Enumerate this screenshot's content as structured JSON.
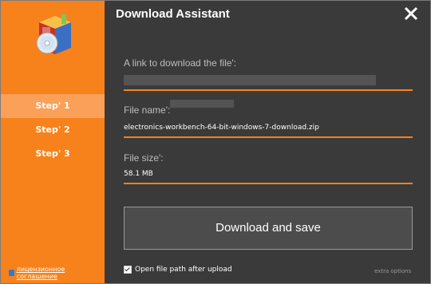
{
  "window": {
    "title": "Download Assistant"
  },
  "sidebar": {
    "steps": [
      {
        "label": "Step' 1",
        "active": true
      },
      {
        "label": "Step' 2",
        "active": false
      },
      {
        "label": "Step' 3",
        "active": false
      }
    ],
    "license_link": "лицензионное соглашение"
  },
  "form": {
    "link_label": "A link to download the file':",
    "link_value": "",
    "filename_label": "File name':",
    "filename_value": "electronics-workbench-64-bit-windows-7-download.zip",
    "filesize_label": "File size':",
    "filesize_value": "58.1 MB"
  },
  "actions": {
    "download_label": "Download and save",
    "open_path_label": "Open file path after upload",
    "open_path_checked": true,
    "extra_options_label": "extra options"
  },
  "colors": {
    "accent": "#f7821b",
    "panel": "#3a3a3a",
    "active_step": "#fba058"
  },
  "icons": {
    "close": "close-icon",
    "logo": "software-box-icon",
    "license": "shield-icon"
  }
}
